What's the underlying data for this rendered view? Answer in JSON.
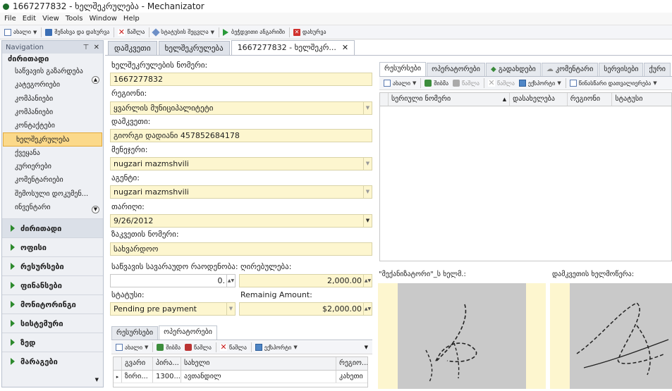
{
  "window": {
    "title": "1667277832 - ხელშეკრულება - Mechanizator"
  },
  "menu": [
    "File",
    "Edit",
    "View",
    "Tools",
    "Window",
    "Help"
  ],
  "toolbar": {
    "new": "ახალი",
    "save_close": "შენახვა და დახურვა",
    "delete": "წაშლა",
    "status_change": "სტატუსის შეცვლა",
    "print_report": "ბეჭდვითი ანგარიში",
    "close": "დახურვა"
  },
  "nav": {
    "header": "Navigation",
    "group_title": "ძირითადი",
    "items": [
      "საწვავის გაზარდება",
      "კატეგორიები",
      "კომპანიები",
      "კომპანიები",
      "კონტაქტები",
      "ხელშეკრულება",
      "ქვეყანა",
      "კურიერები",
      "კომენტარიები",
      "შემოსული დოკუმენ...",
      "ინვენტარი"
    ],
    "selected_index": 5,
    "sections": [
      "ძირითადი",
      "ოფისი",
      "რესურსები",
      "ფინანსები",
      "მონიტორინგი",
      "სისტემური",
      "ზედ",
      "მარაგები"
    ]
  },
  "doctabs": [
    {
      "label": "დამკვეთი",
      "active": false
    },
    {
      "label": "ხელშეკრულება",
      "active": false
    },
    {
      "label": "1667277832 - ხელშეკრ...",
      "active": true
    }
  ],
  "form": {
    "contract_no_label": "ხელშეკრულების ნომერი:",
    "contract_no": "1667277832",
    "region_label": "რეგიონი:",
    "region": "ყვარლის მუნიციპალიტეტი",
    "customer_label": "დამკვეთი:",
    "customer": "გიორგი დადიანი 457852684178",
    "manager_label": "მენეჯერი:",
    "manager": "nugzari mazmshvili",
    "agent_label": "აგენტი:",
    "agent": "nugzari mazmshvili",
    "date_label": "თარიღი:",
    "date": "9/26/2012",
    "invoice_label": "ზაკვეთის ნომერი:",
    "invoice": "სახვარდოო",
    "fuel_amount_label": "საწვავის სავარაუდო რაოდენობა:",
    "fuel_amount": "0.",
    "cost_label": "ღირებულება:",
    "cost": "2,000.00",
    "status_label": "სტატუსი:",
    "status": "Pending pre payment",
    "remaining_label": "Remainig Amount:",
    "remaining": "$2,000.00"
  },
  "bottom_tabs": [
    "რესურსები",
    "ოპერატორები"
  ],
  "bottom_toolbar": {
    "new": "ახალი",
    "save": "შიბმა",
    "open": "წაშლა",
    "delete": "წაშლა",
    "export": "ექსპორტი"
  },
  "bottom_grid": {
    "columns": [
      "გვარი",
      "პირა...",
      "სახელი",
      "რეგიო..."
    ],
    "rows": [
      [
        "ზირი...",
        "1300...",
        "ავთანდილ",
        "კახეთი"
      ]
    ]
  },
  "right_tabs": [
    "რესურსები",
    "ოპერატორები",
    "გადახდები",
    "კომენტარი",
    "სერვისები",
    "ქური"
  ],
  "right_toolbar": {
    "new": "ახალი",
    "link": "შიბმა",
    "save": "წაშლა",
    "delete": "წაშლა",
    "export": "ექსპორტი",
    "report": "წინასწარი დათვალიერება"
  },
  "right_grid": {
    "columns": [
      "სერიული ნომერი",
      "დასახელება",
      "რეგიონი",
      "სტატუსი"
    ]
  },
  "signatures": {
    "mechanizator_label": "\"მექანიზატორი\"_ს ხელმ.:",
    "customer_label": "დამკვეთის ხელმოწერა:"
  }
}
